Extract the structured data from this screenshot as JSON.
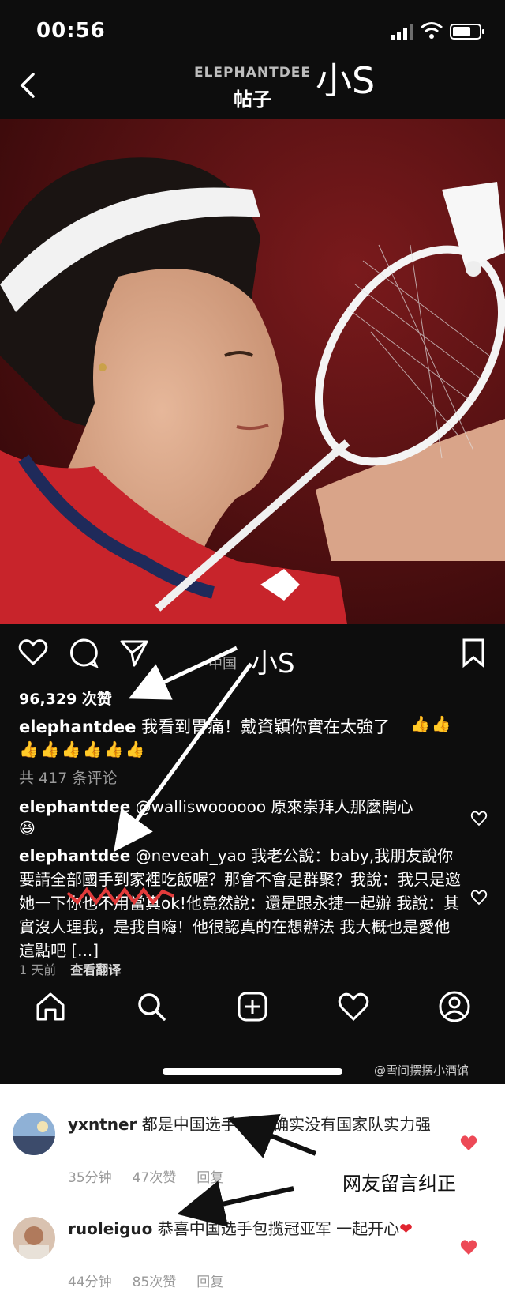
{
  "status": {
    "time": "00:56"
  },
  "header": {
    "username": "ELEPHANTDEE",
    "title": "帖子",
    "annotation": "小S"
  },
  "post": {
    "likes": "96,329 次赞",
    "annotation": "小S",
    "annotation_hidden": "中国",
    "caption_user": "elephantdee",
    "caption_text": " 我看到胃痛！戴資穎你實在太強了",
    "view_comments": "共 417 条评论",
    "comments": [
      {
        "user": "elephantdee",
        "text": " @walliswoooooo 原來崇拜人那麼開心"
      },
      {
        "user": "elephantdee",
        "text": " @neveah_yao 我老公說：baby,我朋友說你要請全部國手到家裡吃飯喔？那會不會是群聚？我說：我只是邀她一下你也不用當真ok!他竟然說：還是跟永捷一起辦 我說：其實沒人理我，是我自嗨！他很認真的在想辦法 我大概也是愛他這點吧 [...]"
      }
    ],
    "time_ago": "1 天前",
    "translate": "查看翻译"
  },
  "watermark": "@雪间摆摆小酒馆",
  "weibo_comments": [
    {
      "user": "yxntner",
      "text": " 都是中国选手 省队确实没有国家队实力强",
      "time": "35分钟",
      "likes": "47次赞",
      "reply": "回复"
    },
    {
      "user": "ruoleiguo",
      "text": " 恭喜中国选手包揽冠亚军 一起开心",
      "time": "44分钟",
      "likes": "85次赞",
      "reply": "回复"
    }
  ],
  "annotation_right": "网友留言纠正",
  "colors": {
    "heart": "#ed4956",
    "phone_bg": "#0d0d0d"
  }
}
